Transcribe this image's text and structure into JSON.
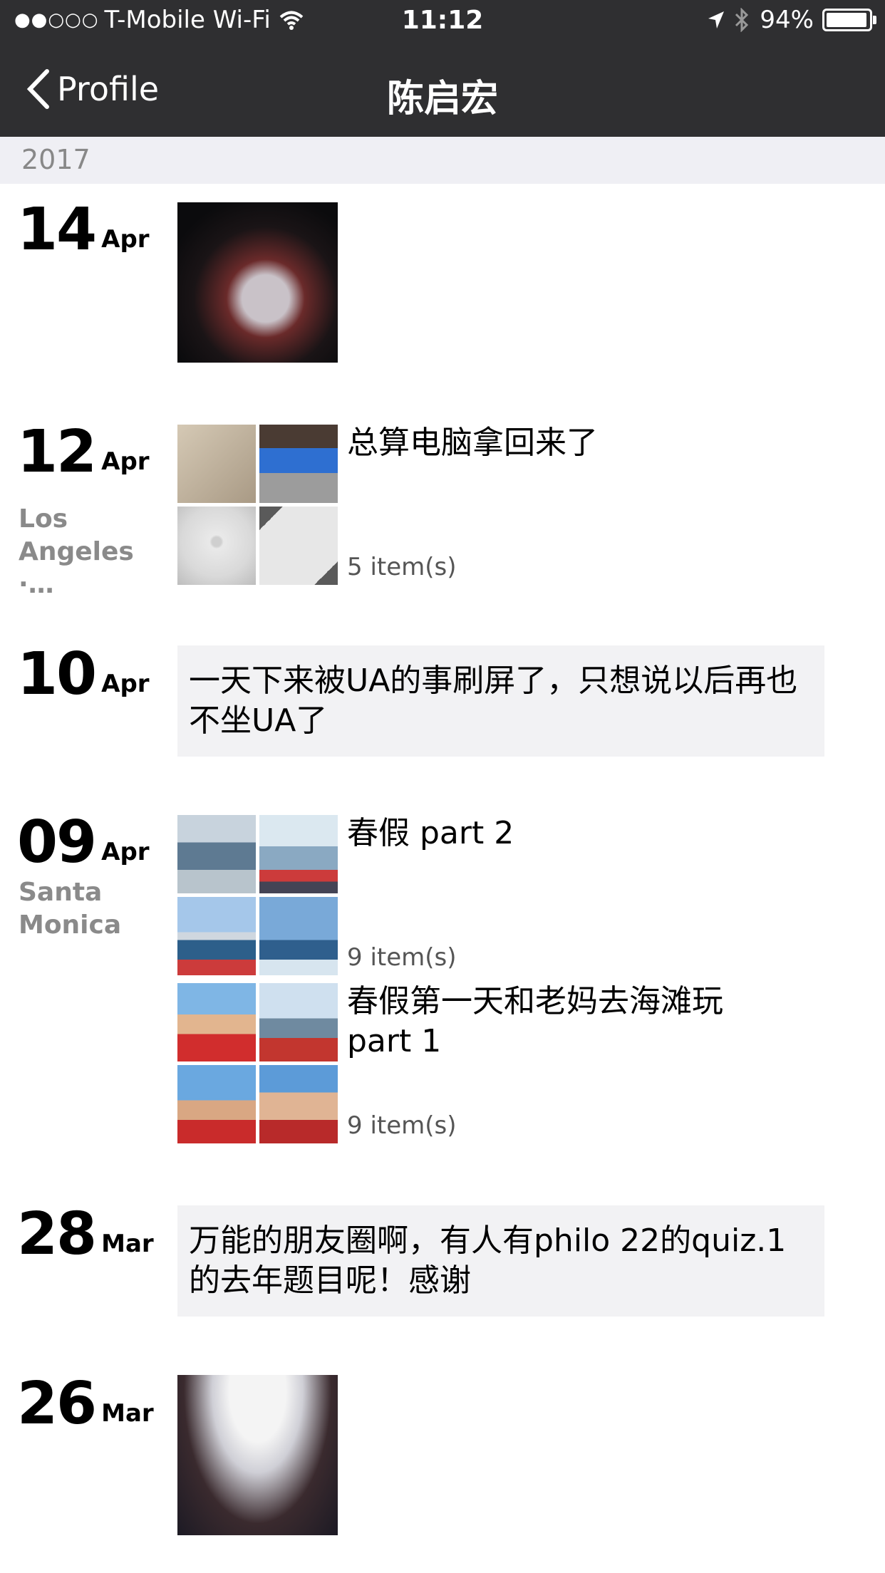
{
  "status_bar": {
    "signal": "●●○○○",
    "carrier": "T-Mobile Wi-Fi",
    "time": "11:12",
    "battery": "94%"
  },
  "nav": {
    "back_label": "Profile",
    "title": "陈启宏"
  },
  "year": "2017",
  "entries": [
    {
      "day": "14",
      "month": "Apr"
    },
    {
      "day": "12",
      "month": "Apr",
      "location": "Los Angeles ·…",
      "caption": "总算电脑拿回来了",
      "count": "5 item(s)"
    },
    {
      "day": "10",
      "month": "Apr",
      "text": "一天下来被UA的事刷屏了，只想说以后再也不坐UA了"
    },
    {
      "day": "09",
      "month": "Apr",
      "location": "Santa Monica",
      "posts": [
        {
          "caption": "春假 part 2",
          "count": "9 item(s)"
        },
        {
          "caption": "春假第一天和老妈去海滩玩part 1",
          "count": "9 item(s)"
        }
      ]
    },
    {
      "day": "28",
      "month": "Mar",
      "text": "万能的朋友圈啊，有人有philo 22的quiz.1的去年题目呢！感谢"
    },
    {
      "day": "26",
      "month": "Mar"
    }
  ]
}
